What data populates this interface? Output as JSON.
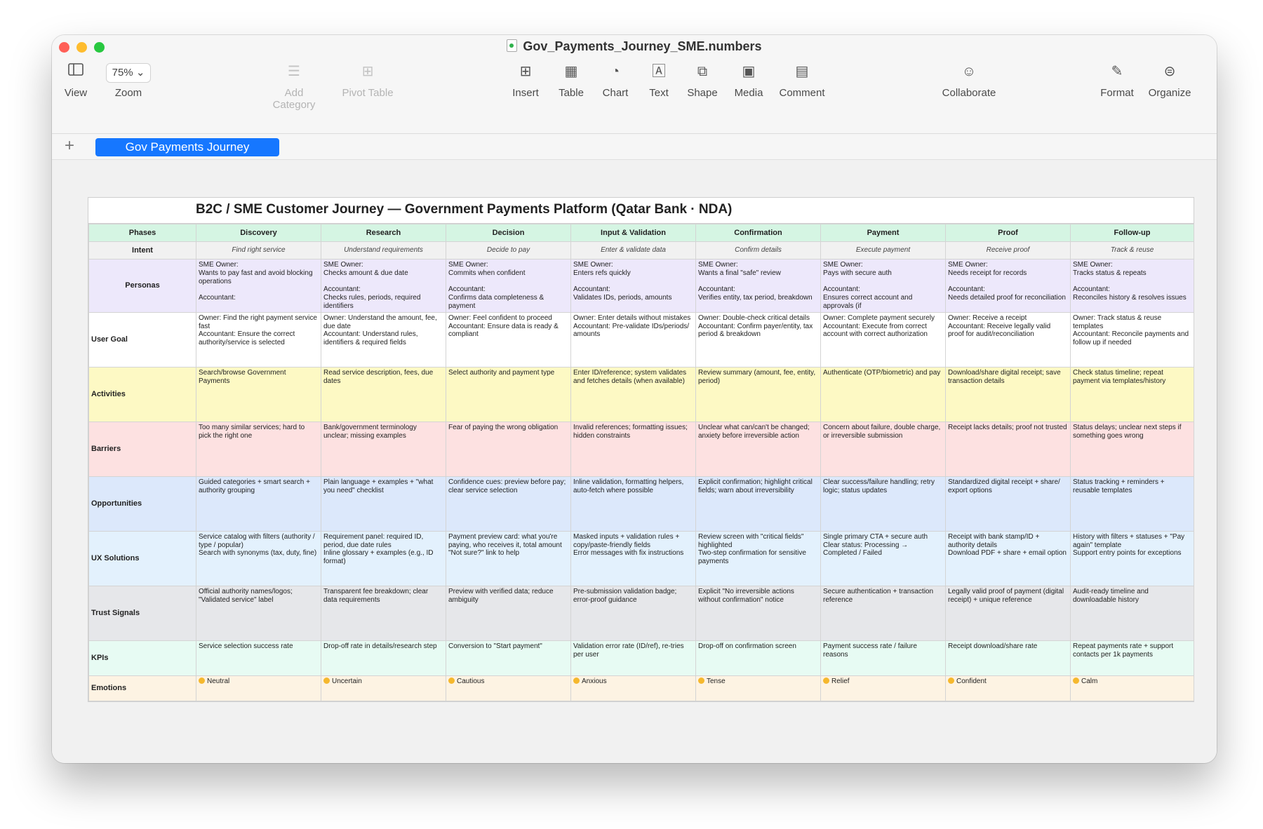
{
  "window": {
    "title": "Gov_Payments_Journey_SME.numbers"
  },
  "toolbar": {
    "view": "View",
    "zoom_value": "75%",
    "zoom": "Zoom",
    "add_category": "Add Category",
    "pivot_table": "Pivot Table",
    "insert": "Insert",
    "table": "Table",
    "chart": "Chart",
    "text": "Text",
    "shape": "Shape",
    "media": "Media",
    "comment": "Comment",
    "collaborate": "Collaborate",
    "format": "Format",
    "organize": "Organize"
  },
  "tabs": {
    "add": "+",
    "active": "Gov Payments Journey"
  },
  "sheet": {
    "title": "B2C / SME Customer Journey — Government Payments Platform (Qatar Bank · NDA)",
    "row_labels": {
      "phases": "Phases",
      "intent": "Intent",
      "personas": "Personas",
      "goal": "User Goal",
      "activities": "Activities",
      "barriers": "Barriers",
      "opportunities": "Opportunities",
      "ux": "UX Solutions",
      "trust": "Trust Signals",
      "kpis": "KPIs",
      "emotions": "Emotions"
    },
    "phases": [
      "Discovery",
      "Research",
      "Decision",
      "Input & Validation",
      "Confirmation",
      "Payment",
      "Proof",
      "Follow-up"
    ],
    "intent": [
      "Find right service",
      "Understand requirements",
      "Decide to pay",
      "Enter & validate data",
      "Confirm details",
      "Execute payment",
      "Receive proof",
      "Track & reuse"
    ],
    "personas": [
      "SME Owner:\nWants to pay fast and avoid blocking operations\n\nAccountant:",
      "SME Owner:\nChecks amount & due date\n\nAccountant:\nChecks rules, periods, required identifiers",
      "SME Owner:\nCommits when confident\n\nAccountant:\nConfirms data completeness & payment",
      "SME Owner:\nEnters refs quickly\n\nAccountant:\nValidates IDs, periods, amounts",
      "SME Owner:\nWants a final \"safe\" review\n\nAccountant:\nVerifies entity, tax period, breakdown",
      "SME Owner:\nPays with secure auth\n\nAccountant:\nEnsures correct account and approvals (if",
      "SME Owner:\nNeeds receipt for records\n\nAccountant:\nNeeds detailed proof for reconciliation",
      "SME Owner:\nTracks status & repeats\n\nAccountant:\nReconciles history & resolves issues"
    ],
    "goal": [
      "Owner: Find the right payment service fast\nAccountant: Ensure the correct authority/service is selected",
      "Owner: Understand the amount, fee, due date\nAccountant: Understand rules, identifiers & required fields",
      "Owner: Feel confident to proceed\nAccountant: Ensure data is ready & compliant",
      "Owner: Enter details without mistakes\nAccountant: Pre-validate IDs/periods/ amounts",
      "Owner: Double-check critical details\nAccountant: Confirm payer/entity, tax period & breakdown",
      "Owner: Complete payment securely\nAccountant: Execute from correct account with correct authorization",
      "Owner: Receive a receipt\nAccountant: Receive legally valid proof for audit/reconciliation",
      "Owner: Track status & reuse templates\nAccountant: Reconcile payments and follow up if needed"
    ],
    "activities": [
      "Search/browse Government Payments",
      "Read service description, fees, due dates",
      "Select authority and payment type",
      "Enter ID/reference; system validates and fetches details (when available)",
      "Review summary (amount, fee, entity, period)",
      "Authenticate (OTP/biometric) and pay",
      "Download/share digital receipt; save transaction details",
      "Check status timeline; repeat payment via templates/history"
    ],
    "barriers": [
      "Too many similar services; hard to pick the right one",
      "Bank/government terminology unclear; missing examples",
      "Fear of paying the wrong obligation",
      "Invalid references; formatting issues; hidden constraints",
      "Unclear what can/can't be changed; anxiety before irreversible action",
      "Concern about failure, double charge, or irreversible submission",
      "Receipt lacks details; proof not trusted",
      "Status delays; unclear next steps if something goes wrong"
    ],
    "opportunities": [
      "Guided categories + smart search + authority grouping",
      "Plain language + examples + \"what you need\" checklist",
      "Confidence cues: preview before pay; clear service selection",
      "Inline validation, formatting helpers, auto-fetch where possible",
      "Explicit confirmation; highlight critical fields; warn about irreversibility",
      "Clear success/failure handling; retry logic; status updates",
      "Standardized digital receipt + share/ export options",
      "Status tracking + reminders + reusable templates"
    ],
    "ux": [
      "Service catalog with filters (authority / type / popular)\nSearch with synonyms (tax, duty, fine)",
      "Requirement panel: required ID, period, due date rules\nInline glossary + examples (e.g., ID format)",
      "Payment preview card: what you're paying, who receives it, total amount\n\"Not sure?\" link to help",
      "Masked inputs + validation rules + copy/paste-friendly fields\nError messages with fix instructions",
      "Review screen with \"critical fields\" highlighted\nTwo-step confirmation for sensitive payments",
      "Single primary CTA + secure auth\nClear status: Processing → Completed / Failed",
      "Receipt with bank stamp/ID + authority details\nDownload PDF + share + email option",
      "History with filters + statuses + \"Pay again\" template\nSupport entry points for exceptions"
    ],
    "trust": [
      "Official authority names/logos; \"Validated service\" label",
      "Transparent fee breakdown; clear data requirements",
      "Preview with verified data; reduce ambiguity",
      "Pre-submission validation badge; error-proof guidance",
      "Explicit \"No irreversible actions without confirmation\" notice",
      "Secure authentication + transaction reference",
      "Legally valid proof of payment (digital receipt) + unique reference",
      "Audit-ready timeline and downloadable history"
    ],
    "kpis": [
      "Service selection success rate",
      "Drop-off rate in details/research step",
      "Conversion to \"Start payment\"",
      "Validation error rate (ID/ref), re-tries per user",
      "Drop-off on confirmation screen",
      "Payment success rate / failure reasons",
      "Receipt download/share rate",
      "Repeat payments rate + support contacts per 1k payments"
    ],
    "emotions": [
      "Neutral",
      "Uncertain",
      "Cautious",
      "Anxious",
      "Tense",
      "Relief",
      "Confident",
      "Calm"
    ]
  }
}
